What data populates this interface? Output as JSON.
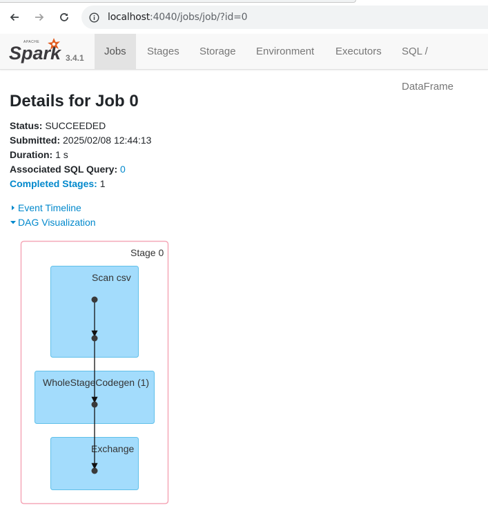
{
  "browser": {
    "url_host": "localhost",
    "url_rest": ":4040/jobs/job/?id=0"
  },
  "navbar": {
    "version": "3.4.1",
    "tabs": [
      "Jobs",
      "Stages",
      "Storage",
      "Environment",
      "Executors",
      "SQL / DataFrame"
    ],
    "active_tab": "Jobs"
  },
  "page": {
    "title": "Details for Job 0",
    "status_label": "Status:",
    "status_value": "SUCCEEDED",
    "submitted_label": "Submitted:",
    "submitted_value": "2025/02/08 12:44:13",
    "duration_label": "Duration:",
    "duration_value": "1 s",
    "sql_label": "Associated SQL Query:",
    "sql_value": "0",
    "stages_label": "Completed Stages:",
    "stages_value": "1",
    "event_timeline": "Event Timeline",
    "dag_visualization": "DAG Visualization"
  },
  "dag": {
    "stage_label": "Stage 0",
    "nodes": [
      "Scan csv",
      "WholeStageCodegen (1)",
      "Exchange"
    ],
    "colors": {
      "stage_border": "#f5a8b8",
      "node_fill": "#a3dcfc",
      "node_border": "#5fbfe9",
      "dot": "#3a3a3a"
    }
  }
}
